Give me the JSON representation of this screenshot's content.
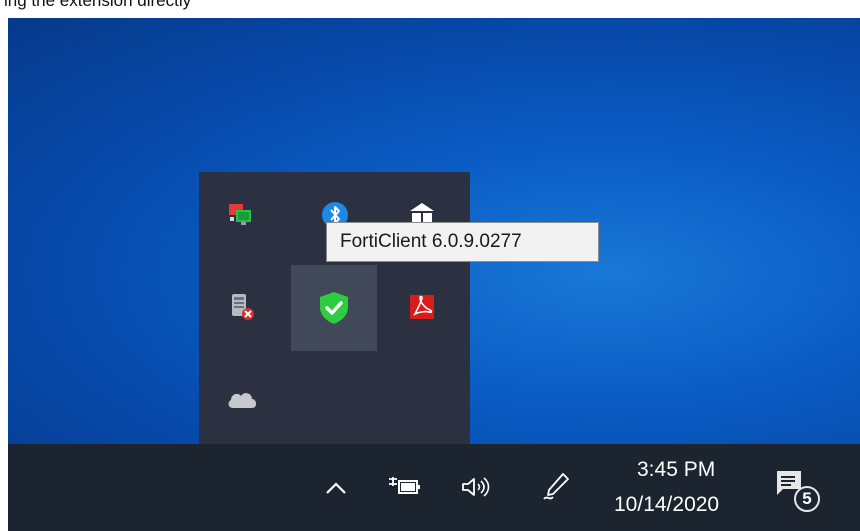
{
  "page": {
    "caption_text": "ing the extension directly"
  },
  "tray": {
    "icons": [
      {
        "name": "display-switch-icon",
        "color": "#e53935"
      },
      {
        "name": "bluetooth-icon",
        "color": "#1e88e5"
      },
      {
        "name": "network-drive-icon",
        "color": "#ffffff"
      },
      {
        "name": "disabled-device-icon",
        "color": "#d32f2f"
      },
      {
        "name": "forticlient-shield-icon",
        "color": "#2ecc40"
      },
      {
        "name": "adobe-acrobat-icon",
        "color": "#d81b1b"
      },
      {
        "name": "onedrive-cloud-icon",
        "color": "#c7c9cc"
      }
    ],
    "selected_icon": "forticlient-shield-icon"
  },
  "tooltip": {
    "text": "FortiClient 6.0.9.0277"
  },
  "taskbar": {
    "time": "3:45 PM",
    "date": "10/14/2020",
    "notification_count": "5",
    "icons": [
      "chevron-up-icon",
      "power-plug-icon",
      "volume-icon",
      "pen-icon",
      "notification-center-icon"
    ]
  },
  "colors": {
    "desktop": "#0a5cc4",
    "flyout": "#2b3140",
    "taskbar": "#1c2430",
    "tooltip_bg": "#f2f2f2"
  }
}
